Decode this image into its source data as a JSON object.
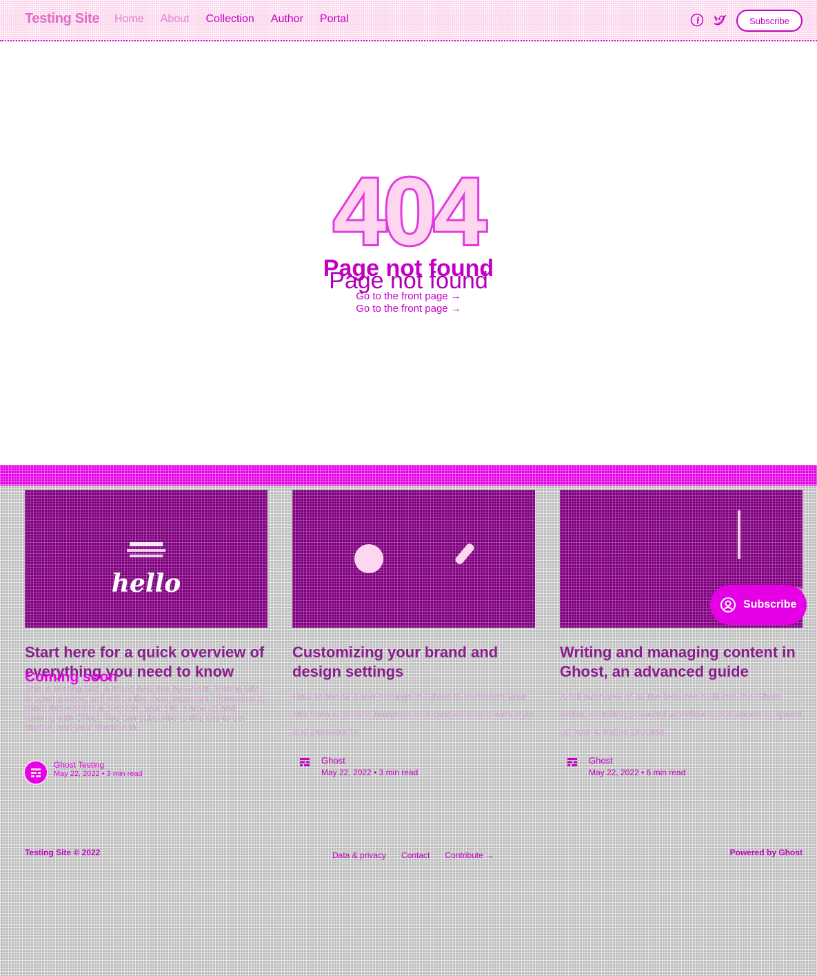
{
  "header": {
    "site_title": "Testing Site",
    "nav": [
      {
        "label": "Home"
      },
      {
        "label": "About"
      },
      {
        "label": "Collection"
      },
      {
        "label": "Author"
      },
      {
        "label": "Portal"
      }
    ],
    "subscribe_label": "Subscribe"
  },
  "error": {
    "code": "404",
    "title": "Page not found",
    "link": "Go to the front page →"
  },
  "cards": [
    {
      "title": "Start here for a quick overview of everything you need to know",
      "overlay_title": "Coming soon",
      "excerpt": "This is Testing Site, a brand new site by Ghost. Testing Site is coming soon, and will be the most important information to make this website a success. Your site is now up and running with Ghost. You can subscribe to this site to get started, and your shortcut to...",
      "author": "Ghost Testing",
      "meta": "May 22, 2022 • 3 min read",
      "image_text": "hello"
    },
    {
      "title": "Customizing your brand and design settings",
      "excerpt": "How to tweak a few settings in Ghost to transform your site from a generic template to a custom brand with style and personality.",
      "author": "Ghost",
      "meta": "May 22, 2022 • 3 min read"
    },
    {
      "title": "Writing and managing content in Ghost, an advanced guide",
      "excerpt": "A full overview of all the features built into the Ghost editor, including powerful workflow automations to speed up your creative process.",
      "author": "Ghost",
      "meta": "May 22, 2022 • 6 min read"
    }
  ],
  "portal": {
    "label": "Subscribe"
  },
  "footer": {
    "copyright": "Testing Site © 2022",
    "links": [
      {
        "label": "Data & privacy"
      },
      {
        "label": "Contact"
      },
      {
        "label": "Contribute →"
      }
    ],
    "powered": "Powered by Ghost"
  },
  "icons": {
    "facebook": "facebook-icon",
    "twitter": "twitter-icon"
  },
  "colors": {
    "accent": "#e600e6",
    "header_bg": "#fbd3ec",
    "footer_bg": "#bdbdbd",
    "card_image_bg": "#800080"
  }
}
